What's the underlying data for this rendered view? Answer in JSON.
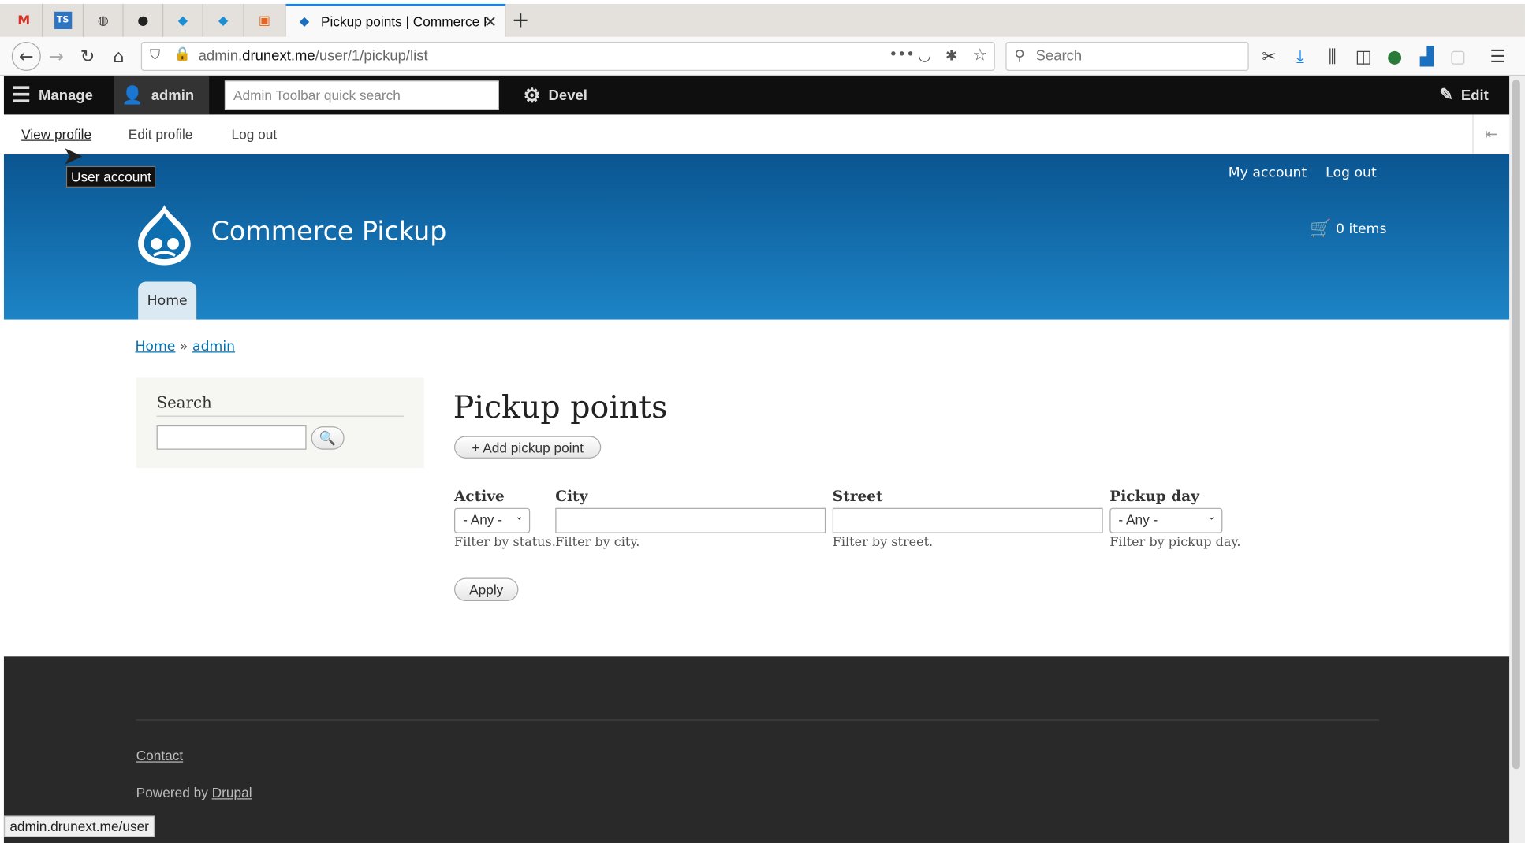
{
  "browser": {
    "tabs": [
      {
        "icon": "gmail-icon",
        "glyph": "M"
      },
      {
        "icon": "ts-icon",
        "glyph": "TS"
      },
      {
        "icon": "globe-icon",
        "glyph": "◍"
      },
      {
        "icon": "github-icon",
        "glyph": "●"
      },
      {
        "icon": "drupal-icon",
        "glyph": "◆"
      },
      {
        "icon": "drupal-icon",
        "glyph": "◆"
      },
      {
        "icon": "package-icon",
        "glyph": "▣"
      }
    ],
    "active_tab_title": "Pickup points | Commerce Pickup",
    "url_host_prefix": "admin.",
    "url_host": "drunext.me",
    "url_path": "/user/1/pickup/list",
    "search_placeholder": "Search",
    "status_url": "admin.drunext.me/user"
  },
  "toolbar": {
    "manage": "Manage",
    "user": "admin",
    "search_placeholder": "Admin Toolbar quick search",
    "devel": "Devel",
    "edit": "Edit",
    "sub_links": [
      "View profile",
      "Edit profile",
      "Log out"
    ],
    "tooltip": "User account"
  },
  "site": {
    "name": "Commerce Pickup",
    "top_links": [
      "My account",
      "Log out"
    ],
    "cart": "0 items",
    "nav_home": "Home"
  },
  "breadcrumb": {
    "home": "Home",
    "sep": "»",
    "user": "admin"
  },
  "sidebar": {
    "search_title": "Search"
  },
  "main": {
    "title": "Pickup points",
    "add_button": "+ Add pickup point",
    "filters": {
      "active": {
        "label": "Active",
        "value": "- Any -",
        "desc": "Filter by status."
      },
      "city": {
        "label": "City",
        "value": "",
        "desc": "Filter by city."
      },
      "street": {
        "label": "Street",
        "value": "",
        "desc": "Filter by street."
      },
      "pickup_day": {
        "label": "Pickup day",
        "value": "- Any -",
        "desc": "Filter by pickup day."
      }
    },
    "apply": "Apply"
  },
  "footer": {
    "contact": "Contact",
    "powered_prefix": "Powered by",
    "powered_link": "Drupal"
  },
  "colors": {
    "header_top": "#0a5591",
    "header_bottom": "#1d84c6",
    "link": "#0071b3",
    "footer": "#292929"
  }
}
